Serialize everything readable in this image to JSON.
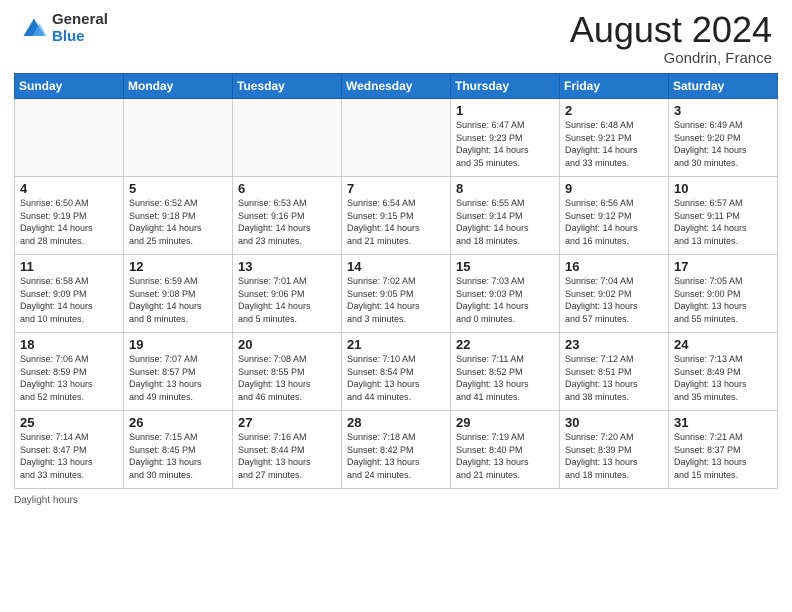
{
  "header": {
    "logo_general": "General",
    "logo_blue": "Blue",
    "month_year": "August 2024",
    "location": "Gondrin, France"
  },
  "days_of_week": [
    "Sunday",
    "Monday",
    "Tuesday",
    "Wednesday",
    "Thursday",
    "Friday",
    "Saturday"
  ],
  "footer": {
    "daylight_hours": "Daylight hours"
  },
  "weeks": [
    [
      {
        "day": "",
        "info": ""
      },
      {
        "day": "",
        "info": ""
      },
      {
        "day": "",
        "info": ""
      },
      {
        "day": "",
        "info": ""
      },
      {
        "day": "1",
        "info": "Sunrise: 6:47 AM\nSunset: 9:23 PM\nDaylight: 14 hours\nand 35 minutes."
      },
      {
        "day": "2",
        "info": "Sunrise: 6:48 AM\nSunset: 9:21 PM\nDaylight: 14 hours\nand 33 minutes."
      },
      {
        "day": "3",
        "info": "Sunrise: 6:49 AM\nSunset: 9:20 PM\nDaylight: 14 hours\nand 30 minutes."
      }
    ],
    [
      {
        "day": "4",
        "info": "Sunrise: 6:50 AM\nSunset: 9:19 PM\nDaylight: 14 hours\nand 28 minutes."
      },
      {
        "day": "5",
        "info": "Sunrise: 6:52 AM\nSunset: 9:18 PM\nDaylight: 14 hours\nand 25 minutes."
      },
      {
        "day": "6",
        "info": "Sunrise: 6:53 AM\nSunset: 9:16 PM\nDaylight: 14 hours\nand 23 minutes."
      },
      {
        "day": "7",
        "info": "Sunrise: 6:54 AM\nSunset: 9:15 PM\nDaylight: 14 hours\nand 21 minutes."
      },
      {
        "day": "8",
        "info": "Sunrise: 6:55 AM\nSunset: 9:14 PM\nDaylight: 14 hours\nand 18 minutes."
      },
      {
        "day": "9",
        "info": "Sunrise: 6:56 AM\nSunset: 9:12 PM\nDaylight: 14 hours\nand 16 minutes."
      },
      {
        "day": "10",
        "info": "Sunrise: 6:57 AM\nSunset: 9:11 PM\nDaylight: 14 hours\nand 13 minutes."
      }
    ],
    [
      {
        "day": "11",
        "info": "Sunrise: 6:58 AM\nSunset: 9:09 PM\nDaylight: 14 hours\nand 10 minutes."
      },
      {
        "day": "12",
        "info": "Sunrise: 6:59 AM\nSunset: 9:08 PM\nDaylight: 14 hours\nand 8 minutes."
      },
      {
        "day": "13",
        "info": "Sunrise: 7:01 AM\nSunset: 9:06 PM\nDaylight: 14 hours\nand 5 minutes."
      },
      {
        "day": "14",
        "info": "Sunrise: 7:02 AM\nSunset: 9:05 PM\nDaylight: 14 hours\nand 3 minutes."
      },
      {
        "day": "15",
        "info": "Sunrise: 7:03 AM\nSunset: 9:03 PM\nDaylight: 14 hours\nand 0 minutes."
      },
      {
        "day": "16",
        "info": "Sunrise: 7:04 AM\nSunset: 9:02 PM\nDaylight: 13 hours\nand 57 minutes."
      },
      {
        "day": "17",
        "info": "Sunrise: 7:05 AM\nSunset: 9:00 PM\nDaylight: 13 hours\nand 55 minutes."
      }
    ],
    [
      {
        "day": "18",
        "info": "Sunrise: 7:06 AM\nSunset: 8:59 PM\nDaylight: 13 hours\nand 52 minutes."
      },
      {
        "day": "19",
        "info": "Sunrise: 7:07 AM\nSunset: 8:57 PM\nDaylight: 13 hours\nand 49 minutes."
      },
      {
        "day": "20",
        "info": "Sunrise: 7:08 AM\nSunset: 8:55 PM\nDaylight: 13 hours\nand 46 minutes."
      },
      {
        "day": "21",
        "info": "Sunrise: 7:10 AM\nSunset: 8:54 PM\nDaylight: 13 hours\nand 44 minutes."
      },
      {
        "day": "22",
        "info": "Sunrise: 7:11 AM\nSunset: 8:52 PM\nDaylight: 13 hours\nand 41 minutes."
      },
      {
        "day": "23",
        "info": "Sunrise: 7:12 AM\nSunset: 8:51 PM\nDaylight: 13 hours\nand 38 minutes."
      },
      {
        "day": "24",
        "info": "Sunrise: 7:13 AM\nSunset: 8:49 PM\nDaylight: 13 hours\nand 35 minutes."
      }
    ],
    [
      {
        "day": "25",
        "info": "Sunrise: 7:14 AM\nSunset: 8:47 PM\nDaylight: 13 hours\nand 33 minutes."
      },
      {
        "day": "26",
        "info": "Sunrise: 7:15 AM\nSunset: 8:45 PM\nDaylight: 13 hours\nand 30 minutes."
      },
      {
        "day": "27",
        "info": "Sunrise: 7:16 AM\nSunset: 8:44 PM\nDaylight: 13 hours\nand 27 minutes."
      },
      {
        "day": "28",
        "info": "Sunrise: 7:18 AM\nSunset: 8:42 PM\nDaylight: 13 hours\nand 24 minutes."
      },
      {
        "day": "29",
        "info": "Sunrise: 7:19 AM\nSunset: 8:40 PM\nDaylight: 13 hours\nand 21 minutes."
      },
      {
        "day": "30",
        "info": "Sunrise: 7:20 AM\nSunset: 8:39 PM\nDaylight: 13 hours\nand 18 minutes."
      },
      {
        "day": "31",
        "info": "Sunrise: 7:21 AM\nSunset: 8:37 PM\nDaylight: 13 hours\nand 15 minutes."
      }
    ]
  ]
}
